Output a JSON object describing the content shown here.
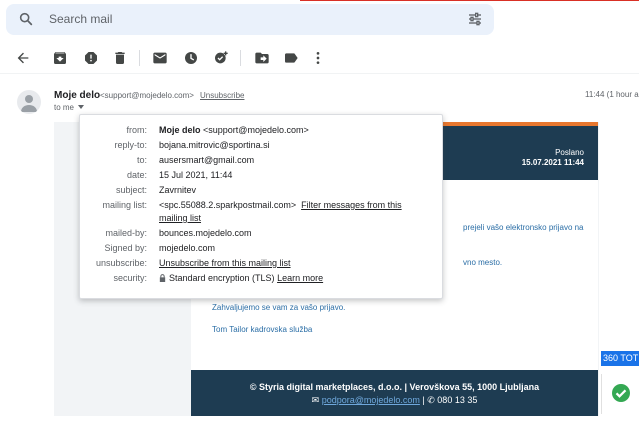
{
  "search": {
    "placeholder": "Search mail"
  },
  "icons": {
    "back": "back-arrow-icon",
    "archive": "archive-icon",
    "spam": "report-spam-icon",
    "delete": "delete-icon",
    "mark_unread": "mark-unread-icon",
    "snooze": "snooze-icon",
    "add_task": "add-task-icon",
    "move": "move-to-icon",
    "label": "label-icon",
    "more": "more-vert-icon",
    "tune": "search-options-icon"
  },
  "message": {
    "sender_name": "Moje delo",
    "sender_email": "<support@mojedelo.com>",
    "unsubscribe": "Unsubscribe",
    "to": "to me",
    "time": "11:44 (1 hour a"
  },
  "details": {
    "from_label": "from:",
    "from_name": "Moje delo",
    "from_email": "<support@mojedelo.com>",
    "replyto_label": "reply-to:",
    "replyto": "bojana.mitrovic@sportina.si",
    "to_label": "to:",
    "to": "ausersmart@gmail.com",
    "date_label": "date:",
    "date": "15 Jul 2021, 11:44",
    "subject_label": "subject:",
    "subject": "Zavrnitev",
    "mailinglist_label": "mailing list:",
    "mailinglist": "<spc.55088.2.sparkpostmail.com>",
    "filter_link_1": "Filter messages from this",
    "filter_link_2": "mailing list",
    "mailedby_label": "mailed-by:",
    "mailedby": "bounces.mojedelo.com",
    "signedby_label": "Signed by:",
    "signedby": "mojedelo.com",
    "unsubscribe_label": "unsubscribe:",
    "unsubscribe": "Unsubscribe from this mailing list",
    "security_label": "security:",
    "security": "Standard encryption (TLS)",
    "learn_more": "Learn more"
  },
  "email_body": {
    "posted": "Poslano",
    "posted_date": "15.07.2021 11:44",
    "line1": "prejeli vašo elektronsko prijavo na",
    "line2": "vno mesto.",
    "line3": "Zahvaljujemo se vam za vašo prijavo.",
    "line4": "Tom Tailor kadrovska služba",
    "footer_company": "© Styria digital marketplaces, d.o.o. | Verovškova 55, 1000 Ljubljana",
    "footer_email": "podpora@mojedelo.com",
    "footer_phone": "| ✆ 080 13 35"
  },
  "side": {
    "badge": "360 TOT"
  }
}
